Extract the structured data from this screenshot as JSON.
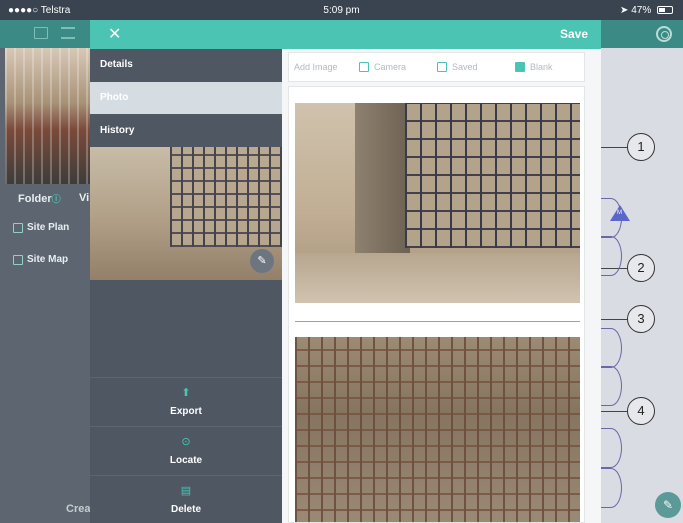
{
  "status_bar": {
    "carrier": "●●●●○ Telstra",
    "time": "5:09 pm",
    "battery": "47%"
  },
  "background": {
    "folder_label": "Folder",
    "view_label_partial": "Vi",
    "sidebar_items": [
      {
        "label": "Site Plan"
      },
      {
        "label": "Site Map"
      }
    ],
    "create_partial": "Crea"
  },
  "modal": {
    "close_icon": "✕",
    "save_label": "Save",
    "tabs": [
      {
        "label": "Details"
      },
      {
        "label": "Photo"
      },
      {
        "label": "History"
      }
    ],
    "actions": [
      {
        "label": "Export",
        "icon": "export-icon"
      },
      {
        "label": "Locate",
        "icon": "location-pin-icon"
      },
      {
        "label": "Delete",
        "icon": "trash-icon"
      }
    ],
    "add_image": {
      "label": "Add Image",
      "options": [
        {
          "label": "Camera"
        },
        {
          "label": "Saved"
        },
        {
          "label": "Blank"
        }
      ]
    }
  },
  "drawing": {
    "callouts": [
      "1",
      "2",
      "3",
      "4"
    ],
    "marker_label": "M"
  },
  "colors": {
    "accent": "#4bc4b4",
    "panel": "#4e5762",
    "active_tab": "#d6dde2"
  }
}
